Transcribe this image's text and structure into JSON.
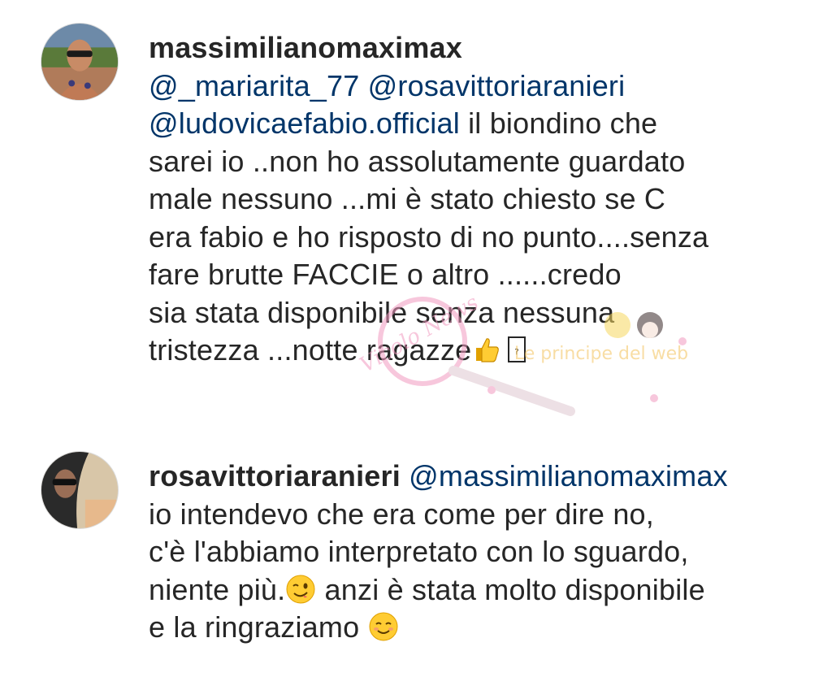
{
  "comments": [
    {
      "username": "massimilianomaximax",
      "avatar_icon": "profile-photo-man-sunglasses",
      "lines": [
        {
          "mentions": [
            "@_mariarita_77",
            "@rosavittoriaranieri"
          ],
          "text": ""
        },
        {
          "mentions": [
            "@ludovicaefabio.official"
          ],
          "text": " il biondino che"
        },
        {
          "text": "sarei io ..non ho assolutamente guardato"
        },
        {
          "text": "male nessuno ...mi è stato chiesto se C"
        },
        {
          "text": "era fabio e ho risposto di no punto....senza"
        },
        {
          "text": "fare brutte FACCIE o altro ......credo"
        },
        {
          "text": "sia stata disponibile senza nessuna"
        },
        {
          "text": "tristezza ...notte ragazze"
        }
      ],
      "trailing_emoji": [
        "thumbs-up-icon",
        "unknown-glyph-box"
      ]
    },
    {
      "username": "rosavittoriaranieri",
      "avatar_icon": "profile-photo-woman-sunglasses",
      "first_mention": "@massimilianomaximax",
      "lines": [
        {
          "text": "io intendevo che era come per dire no,"
        },
        {
          "text": "c'è l'abbiamo interpretato con lo sguardo,"
        },
        {
          "text_before": "niente più.",
          "emoji": "winking-face-icon",
          "text_after": " anzi è stata molto disponibile"
        },
        {
          "text_before": "e la ringraziamo ",
          "emoji": "smiling-face-icon"
        }
      ]
    }
  ],
  "watermark": {
    "logo_text": "Vicolo News",
    "side_text": "Le principe del web"
  },
  "colors": {
    "text": "#262626",
    "mention": "#003569",
    "watermark_pink": "#f29ac0"
  }
}
